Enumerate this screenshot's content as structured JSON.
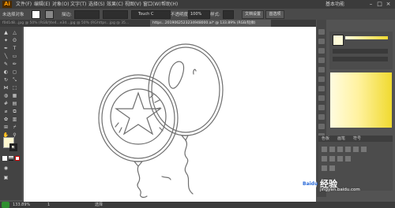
{
  "app": {
    "logo": "Ai"
  },
  "menubar": {
    "items": [
      "文件(F)",
      "编辑(E)",
      "对象(O)",
      "文字(T)",
      "选择(S)",
      "效果(C)",
      "视图(V)",
      "窗口(W)",
      "帮助(H)"
    ],
    "workspace": "基本功能"
  },
  "control": {
    "selection": "未选择对象",
    "stroke_label": "描边:",
    "stroke_value": "1 pt",
    "brush": "Touch C",
    "opacity_label": "不透明度:",
    "opacity_value": "100%",
    "style_label": "样式:",
    "doc_settings": "文档设置",
    "prefs": "首选项"
  },
  "tabs": [
    "f0d1d8...jpg @ 50% (RGB/预览)",
    "4e4...e3d...jpg @ 50% (RGB/预览)",
    "https...jpg @ 35...",
    "https...2019062523234948000.ai* @ 133.89% (RGB/轮廓)"
  ],
  "panel": {
    "swatch_tabs": [
      "色板",
      "画笔",
      "符号"
    ]
  },
  "status": {
    "zoom": "133.89%",
    "page": "1",
    "mode": "选择"
  },
  "watermark": {
    "text": "经验",
    "sub": "jingyan.baidu.com",
    "brand": "Baidu"
  },
  "colors": {
    "accent": "#ff9a00",
    "canvas": "#ffffff",
    "panel": "#535353",
    "gradient_end": "#f0da30"
  }
}
